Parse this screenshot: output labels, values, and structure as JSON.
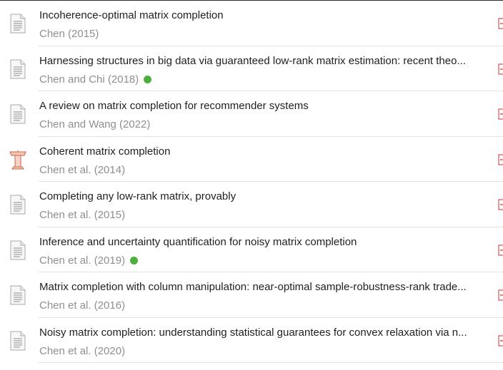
{
  "items": [
    {
      "title": "Incoherence-optimal matrix completion",
      "meta": "Chen (2015)",
      "icon": "document-icon",
      "badge": false
    },
    {
      "title": "Harnessing structures in big data via guaranteed low-rank matrix estimation: recent theo...",
      "meta": "Chen and Chi (2018)",
      "icon": "document-icon",
      "badge": true
    },
    {
      "title": "A review on matrix completion for recommender systems",
      "meta": "Chen and Wang (2022)",
      "icon": "document-icon",
      "badge": false
    },
    {
      "title": "Coherent matrix completion",
      "meta": "Chen et al. (2014)",
      "icon": "conference-paper-icon",
      "badge": false
    },
    {
      "title": "Completing any low-rank matrix, provably",
      "meta": "Chen et al. (2015)",
      "icon": "document-icon",
      "badge": false
    },
    {
      "title": "Inference and uncertainty quantification for noisy matrix completion",
      "meta": "Chen et al. (2019)",
      "icon": "document-icon",
      "badge": true
    },
    {
      "title": "Matrix completion with column manipulation: near-optimal sample-robustness-rank trade...",
      "meta": "Chen et al. (2016)",
      "icon": "document-icon",
      "badge": false
    },
    {
      "title": "Noisy matrix completion: understanding statistical guarantees for convex relaxation via n...",
      "meta": "Chen et al. (2020)",
      "icon": "document-icon",
      "badge": false
    }
  ],
  "colors": {
    "badge": "#4caf3c",
    "pdf_accent": "#d9534f",
    "conference_icon": "#f3c6b3"
  }
}
